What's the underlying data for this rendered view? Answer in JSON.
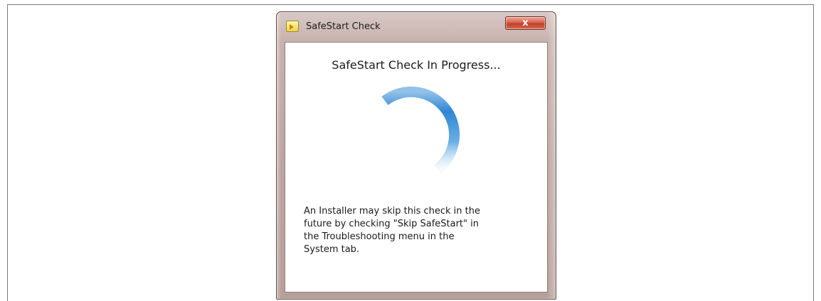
{
  "window": {
    "title": "SafeStart Check",
    "close_label": "x",
    "icon": "app-icon"
  },
  "dialog": {
    "heading": "SafeStart Check In Progress...",
    "spinner_icon": "loading-spinner-icon",
    "message_lines": [
      "An Installer may skip this check in the",
      "future by checking \"Skip SafeStart\" in",
      "the Troubleshooting menu in the",
      "System tab."
    ]
  },
  "colors": {
    "spinner": "#3a8ed6",
    "close_button": "#c9503a",
    "frame": "#bda6a1"
  }
}
